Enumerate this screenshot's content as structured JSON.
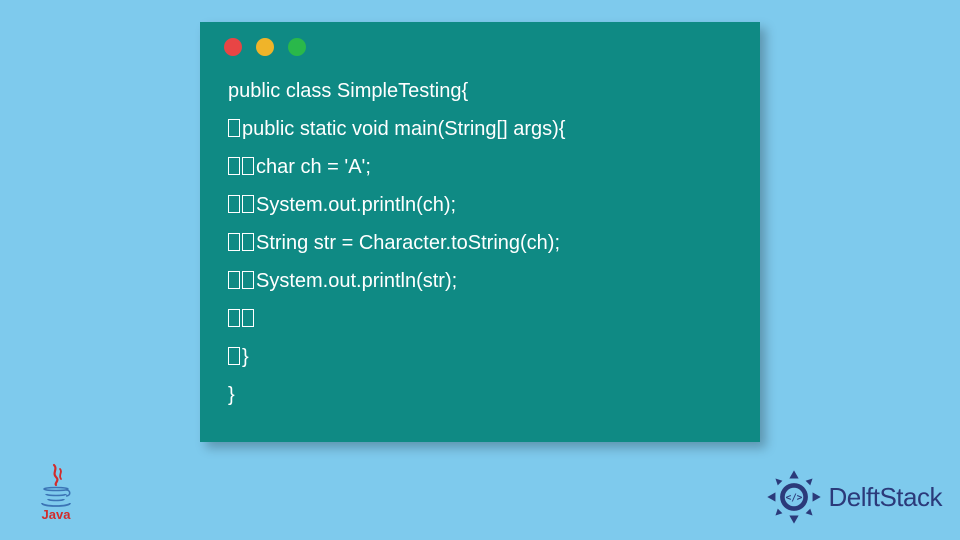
{
  "window": {
    "dots": [
      "red",
      "yellow",
      "green"
    ]
  },
  "code": {
    "lines": [
      {
        "indent": 0,
        "text": "public class SimpleTesting{"
      },
      {
        "indent": 1,
        "text": "public static void main(String[] args){"
      },
      {
        "indent": 2,
        "text": "char ch = 'A';"
      },
      {
        "indent": 2,
        "text": "System.out.println(ch);"
      },
      {
        "indent": 2,
        "text": "String str = Character.toString(ch);"
      },
      {
        "indent": 2,
        "text": "System.out.println(str);"
      },
      {
        "indent": 2,
        "text": ""
      },
      {
        "indent": 1,
        "text": "}"
      },
      {
        "indent": 0,
        "text": "}"
      }
    ]
  },
  "logos": {
    "java_label": "Java",
    "delft_label": "DelftStack"
  },
  "colors": {
    "background": "#7ecaed",
    "window": "#0f8a84",
    "code_text": "#ffffff",
    "delft_primary": "#2b3a7a",
    "java_red": "#d12c2c"
  }
}
